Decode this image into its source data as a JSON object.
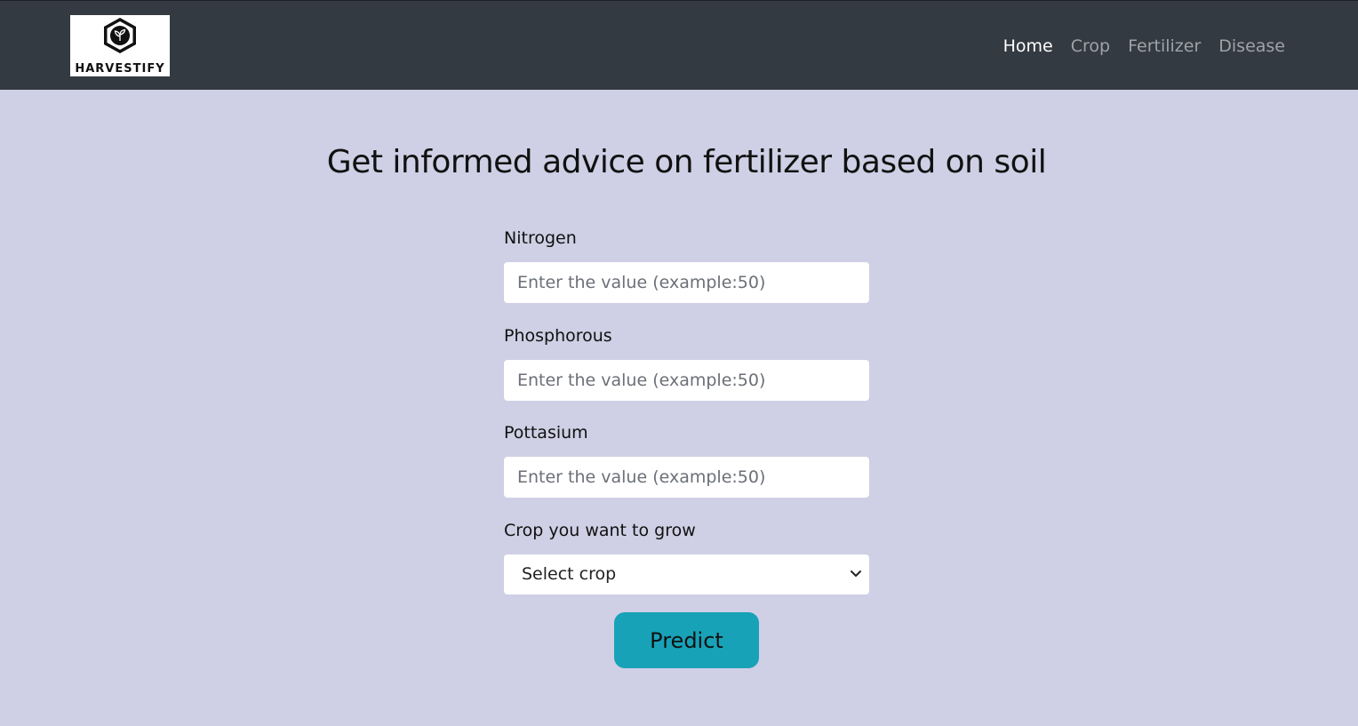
{
  "brand": {
    "name": "HARVESTIFY",
    "icon": "sprout-hexagon-logo"
  },
  "nav": {
    "items": [
      {
        "label": "Home",
        "active": true
      },
      {
        "label": "Crop",
        "active": false
      },
      {
        "label": "Fertilizer",
        "active": false
      },
      {
        "label": "Disease",
        "active": false
      }
    ]
  },
  "main": {
    "title": "Get informed advice on fertilizer based on soil",
    "fields": [
      {
        "label": "Nitrogen",
        "placeholder": "Enter the value (example:50)",
        "value": ""
      },
      {
        "label": "Phosphorous",
        "placeholder": "Enter the value (example:50)",
        "value": ""
      },
      {
        "label": "Pottasium",
        "placeholder": "Enter the value (example:50)",
        "value": ""
      }
    ],
    "crop_select": {
      "label": "Crop you want to grow",
      "selected": "Select crop",
      "icon": "chevron-down-icon"
    },
    "submit_label": "Predict"
  },
  "colors": {
    "navbar_bg": "#343a42",
    "page_bg": "#cfcfe5",
    "button_bg": "#17a2b8",
    "nav_active": "#ffffff",
    "nav_inactive": "#9da3a9"
  }
}
